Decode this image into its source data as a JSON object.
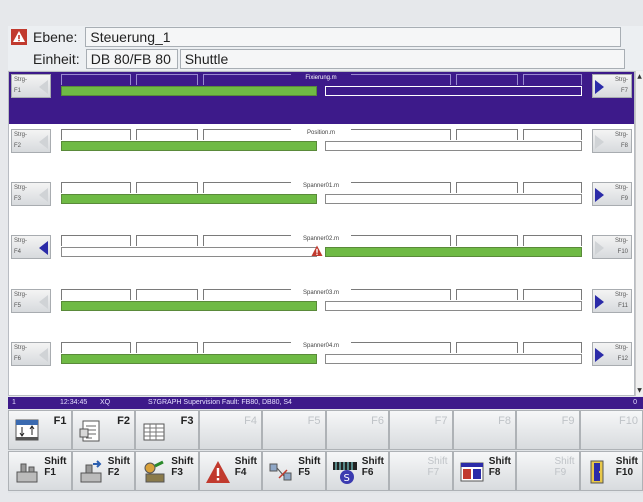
{
  "header": {
    "level_label": "Ebene:",
    "level_value": "Steuerung_1",
    "unit_label": "Einheit:",
    "unit_value_1": "DB 80/FB 80",
    "unit_value_2": "Shuttle"
  },
  "rows": [
    {
      "left_top": "Strg-",
      "left_bottom": "F1",
      "right_top": "Strg-",
      "right_bottom": "F7",
      "name": "Fixierung.m",
      "state": "left",
      "highlight": true
    },
    {
      "left_top": "Strg-",
      "left_bottom": "F2",
      "right_top": "Strg-",
      "right_bottom": "F8",
      "name": "Position.m",
      "state": "left"
    },
    {
      "left_top": "Strg-",
      "left_bottom": "F3",
      "right_top": "Strg-",
      "right_bottom": "F9",
      "name": "Spanner01.m",
      "state": "left"
    },
    {
      "left_top": "Strg-",
      "left_bottom": "F4",
      "right_top": "Strg-",
      "right_bottom": "F10",
      "name": "Spanner02.m",
      "state": "right",
      "fault": true
    },
    {
      "left_top": "Strg-",
      "left_bottom": "F5",
      "right_top": "Strg-",
      "right_bottom": "F11",
      "name": "Spanner03.m",
      "state": "left"
    },
    {
      "left_top": "Strg-",
      "left_bottom": "F6",
      "right_top": "Strg-",
      "right_bottom": "F12",
      "name": "Spanner04.m",
      "state": "left"
    }
  ],
  "status_bar": {
    "index": "1",
    "time": "12:34:45",
    "code": "XQ",
    "message": "S7GRAPH Supervision Fault: FB80, DB80, S4",
    "count": "0"
  },
  "fkeys_row1": [
    {
      "label": "F1",
      "icon": "transition-icon",
      "enabled": true
    },
    {
      "label": "F2",
      "icon": "document-list-icon",
      "enabled": true
    },
    {
      "label": "F3",
      "icon": "table-icon",
      "enabled": true
    },
    {
      "label": "F4",
      "icon": "",
      "enabled": false
    },
    {
      "label": "F5",
      "icon": "",
      "enabled": false
    },
    {
      "label": "F6",
      "icon": "",
      "enabled": false
    },
    {
      "label": "F7",
      "icon": "",
      "enabled": false
    },
    {
      "label": "F8",
      "icon": "",
      "enabled": false
    },
    {
      "label": "F9",
      "icon": "",
      "enabled": false
    },
    {
      "label": "F10",
      "icon": "",
      "enabled": false
    }
  ],
  "fkeys_row2": [
    {
      "shift": "Shift",
      "label": "F1",
      "icon": "machine-icon",
      "enabled": true
    },
    {
      "shift": "Shift",
      "label": "F2",
      "icon": "machine-arrow-icon",
      "enabled": true
    },
    {
      "shift": "Shift",
      "label": "F3",
      "icon": "tools-icon",
      "enabled": true
    },
    {
      "shift": "Shift",
      "label": "F4",
      "icon": "warning-icon",
      "enabled": true
    },
    {
      "shift": "Shift",
      "label": "F5",
      "icon": "network-icon",
      "enabled": true
    },
    {
      "shift": "Shift",
      "label": "F6",
      "icon": "step-icon",
      "enabled": true
    },
    {
      "shift": "Shift",
      "label": "F7",
      "icon": "",
      "enabled": false
    },
    {
      "shift": "Shift",
      "label": "F8",
      "icon": "window-icon",
      "enabled": true
    },
    {
      "shift": "Shift",
      "label": "F9",
      "icon": "",
      "enabled": false
    },
    {
      "shift": "Shift",
      "label": "F10",
      "icon": "exit-icon",
      "enabled": true
    }
  ],
  "colors": {
    "accent": "#3d1a8a",
    "active_bar": "#6fba45",
    "fault": "#c0392b"
  }
}
